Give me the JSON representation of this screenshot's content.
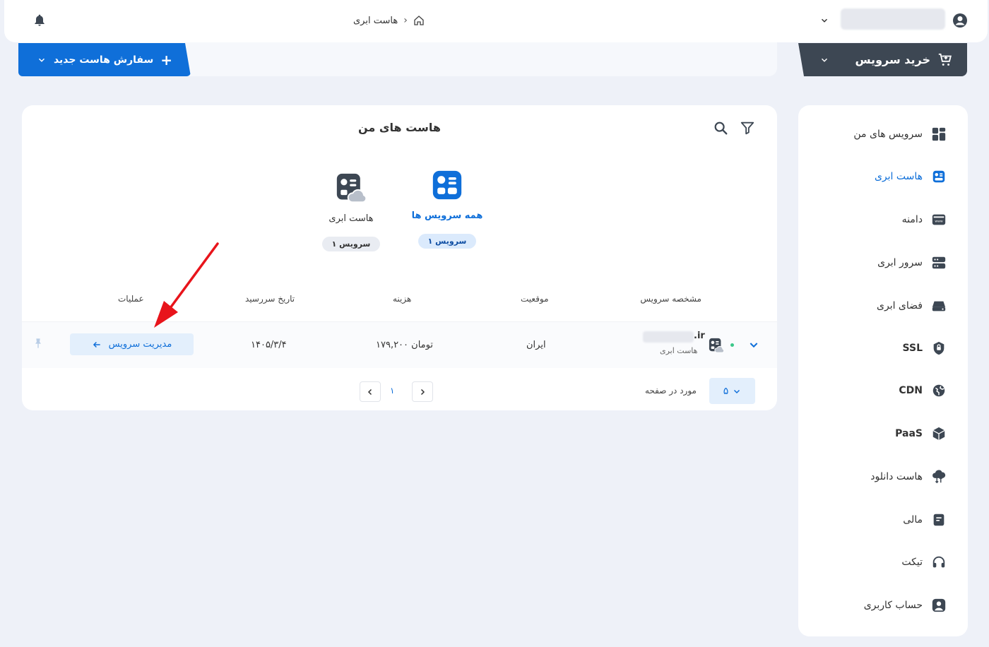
{
  "header": {
    "breadcrumb": [
      "هاست ابری"
    ]
  },
  "toolbar": {
    "order_new_host": "سفارش هاست جدید",
    "buy_service": "خرید سرویس"
  },
  "sidebar": {
    "items": [
      {
        "label": "سرویس های من",
        "icon": "grid-icon"
      },
      {
        "label": "هاست ابری",
        "icon": "cloud-host-icon",
        "active": true
      },
      {
        "label": "دامنه",
        "icon": "domain-icon"
      },
      {
        "label": "سرور ابری",
        "icon": "server-icon"
      },
      {
        "label": "فضای ابری",
        "icon": "cloud-storage-icon"
      },
      {
        "label": "SSL",
        "icon": "shield-icon"
      },
      {
        "label": "CDN",
        "icon": "globe-icon"
      },
      {
        "label": "PaaS",
        "icon": "cube-icon"
      },
      {
        "label": "هاست دانلود",
        "icon": "download-cloud-icon"
      },
      {
        "label": "مالی",
        "icon": "finance-icon"
      },
      {
        "label": "تیکت",
        "icon": "headset-icon"
      },
      {
        "label": "حساب کاربری",
        "icon": "user-icon"
      }
    ]
  },
  "main": {
    "title": "هاست های من",
    "categories": [
      {
        "label": "همه سرویس ها",
        "count": "۱ سرویس",
        "active": true
      },
      {
        "label": "هاست ابری",
        "count": "۱ سرویس",
        "active": false
      }
    ],
    "table": {
      "headers": [
        "مشخصه سرویس",
        "موقعیت",
        "هزینه",
        "تاریخ سررسید",
        "عملیات"
      ],
      "rows": [
        {
          "name": ".ir",
          "type": "هاست ابری",
          "location": "ایران",
          "cost": "۱۷۹,۲۰۰ تومان",
          "due": "۱۴۰۵/۳/۴",
          "action": "مدیریت سرویس"
        }
      ]
    },
    "pagination": {
      "per_page_value": "۵",
      "per_page_label": "مورد در صفحه",
      "current_page": "۱"
    }
  },
  "colors": {
    "accent": "#0f6fd9",
    "dark": "#3d4753",
    "annotation": "#e8141b"
  }
}
